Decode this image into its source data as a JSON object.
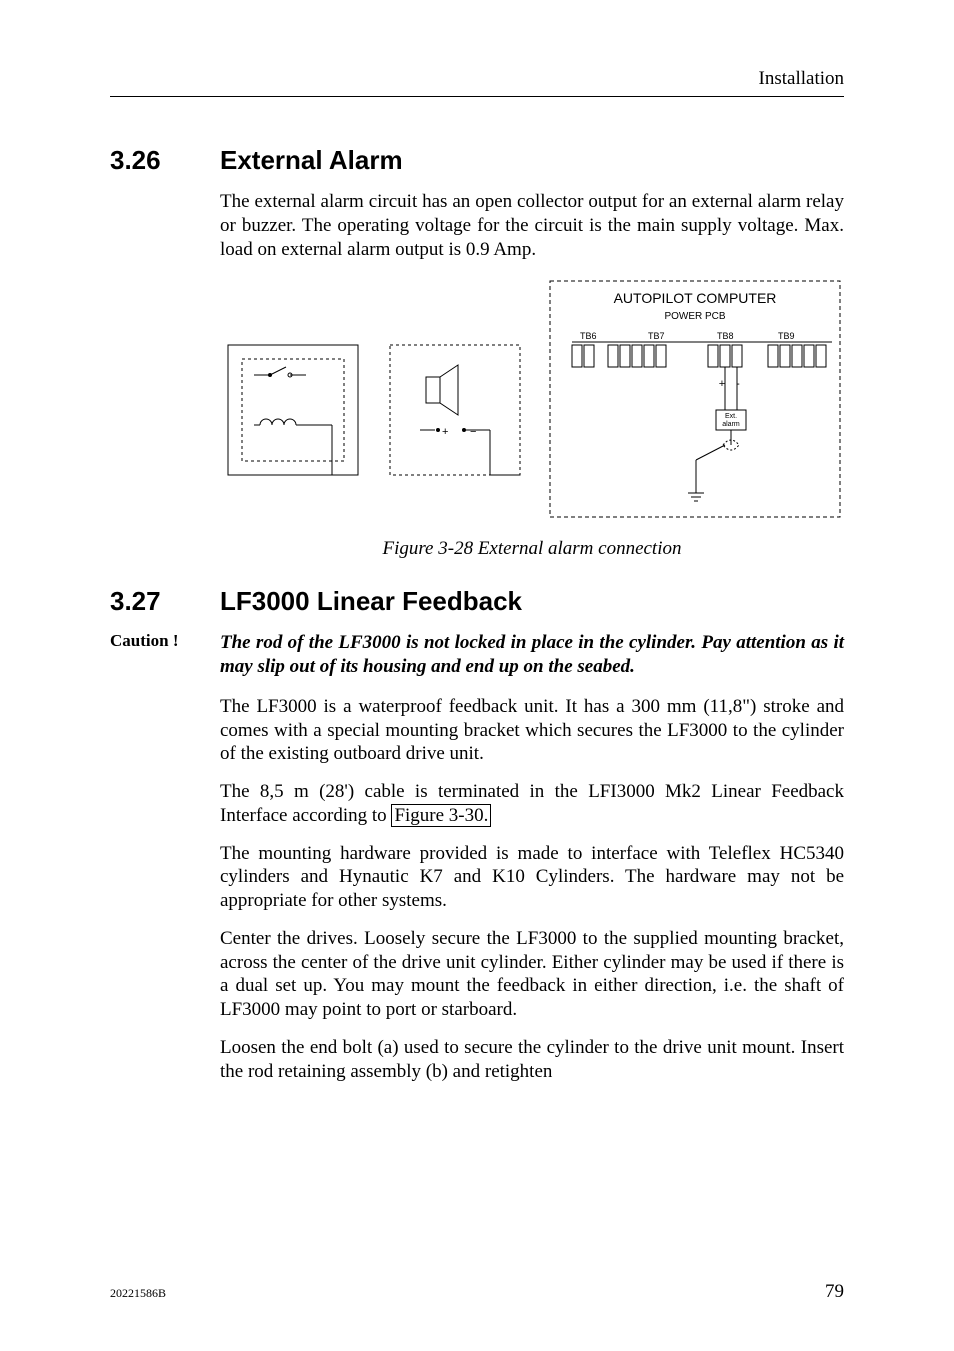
{
  "header": {
    "running": "Installation"
  },
  "section1": {
    "number": "3.26",
    "title": "External Alarm",
    "p1": "The external alarm circuit has an open collector output for an external alarm relay or buzzer. The operating voltage for the circuit is the main supply voltage. Max. load on external alarm output is 0.9 Amp."
  },
  "figure1": {
    "caption": "Figure   3-28 External alarm connection",
    "labels": {
      "computer": "AUTOPILOT COMPUTER",
      "power": "POWER PCB",
      "tb6": "TB6",
      "tb7": "TB7",
      "tb8": "TB8",
      "tb9": "TB9",
      "extalarm1": "Ext.",
      "extalarm2": "alarm",
      "plus": "+",
      "minus": "−"
    }
  },
  "chart_data": {
    "type": "table",
    "description": "Wiring diagram — external alarm connection",
    "left_devices": [
      "relay (inductor with contacts)",
      "buzzer (+/−)"
    ],
    "right_block": {
      "title": "AUTOPILOT COMPUTER",
      "subtitle": "POWER PCB",
      "terminal_blocks": [
        "TB6",
        "TB7",
        "TB8",
        "TB9"
      ],
      "signal": "Ext. alarm (+ / −)",
      "grounded": true
    }
  },
  "section2": {
    "number": "3.27",
    "title": "LF3000 Linear Feedback",
    "caution_label": "Caution !",
    "caution_text": "The rod of the LF3000 is not locked in place in the cylinder. Pay attention as it may slip out of its housing and end up on the seabed.",
    "p1": "The LF3000 is a waterproof feedback unit. It has a 300 mm (11,8\") stroke and comes with a special mounting bracket which secures the LF3000 to the cylinder of the existing outboard drive unit.",
    "p2a": "The 8,5 m (28') cable is terminated in the LFI3000 Mk2 Linear Feedback Interface according to ",
    "p2_link": "Figure 3-30.",
    "p3": "The mounting hardware provided is made to interface with Teleflex HC5340 cylinders and Hynautic K7 and K10 Cylinders. The hardware may not be appropriate for other systems.",
    "p4": "Center the drives. Loosely secure the LF3000 to the supplied mounting bracket, across the center of the drive unit cylinder. Either cylinder may be used if there is a dual set up. You may mount the feedback in either direction, i.e. the shaft of LF3000 may point to port or starboard.",
    "p5": "Loosen the end bolt (a) used to secure the cylinder to the drive unit mount. Insert the rod retaining assembly (b) and retighten"
  },
  "footer": {
    "left": "20221586B",
    "right": "79"
  }
}
